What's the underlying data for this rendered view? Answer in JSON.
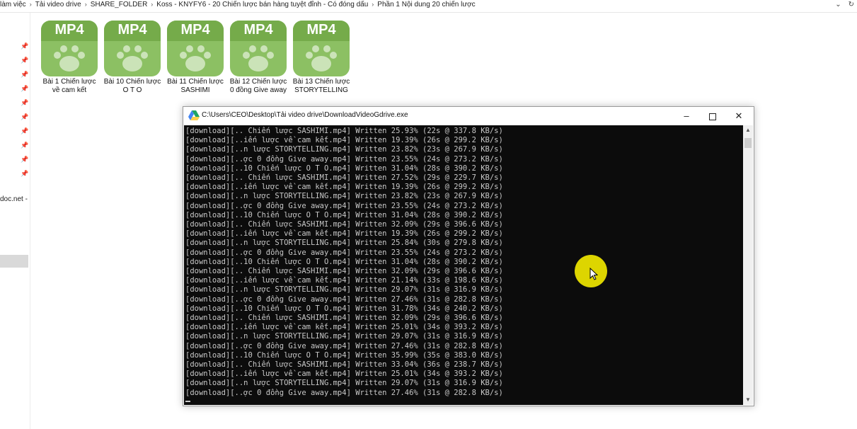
{
  "explorer": {
    "breadcrumb": [
      "làm việc",
      "Tải video drive",
      "SHARE_FOLDER",
      "Koss - KNYFY6 - 20 Chiến lược bán hàng tuyệt đỉnh - Có đóng dấu",
      "Phần 1 Nội dung 20 chiến lược"
    ],
    "sidebar_text": "doc.net -",
    "files": [
      {
        "badge": "MP4",
        "name": "Bài 1 Chiến lược về cam kết"
      },
      {
        "badge": "MP4",
        "name": "Bài 10 Chiến lược O T O"
      },
      {
        "badge": "MP4",
        "name": "Bài 11 Chiến lược SASHIMI"
      },
      {
        "badge": "MP4",
        "name": "Bài 12 Chiến lược 0 đồng Give away"
      },
      {
        "badge": "MP4",
        "name": "Bài 13 Chiến lược STORYTELLING"
      }
    ],
    "icons": {
      "chevron": "chevron-right-icon",
      "pin": "pin-icon",
      "file": "mp4-file-icon",
      "refresh": "refresh-icon"
    }
  },
  "console": {
    "title": "C:\\Users\\CEO\\Desktop\\Tải video drive\\DownloadVideoGdrive.exe",
    "buttons": {
      "minimize": "–",
      "close": "✕"
    },
    "lines": [
      "[download][.. Chiến lược SASHIMI.mp4] Written 25.93% (22s @ 337.8 KB/s)",
      "[download][..iến lược về cam kết.mp4] Written 19.39% (26s @ 299.2 KB/s)",
      "[download][..n lược STORYTELLING.mp4] Written 23.82% (23s @ 267.9 KB/s)",
      "[download][..ợc 0 đồng Give away.mp4] Written 23.55% (24s @ 273.2 KB/s)",
      "[download][..10 Chiến lược O T O.mp4] Written 31.04% (28s @ 390.2 KB/s)",
      "[download][.. Chiến lược SASHIMI.mp4] Written 27.52% (29s @ 229.7 KB/s)",
      "[download][..iến lược về cam kết.mp4] Written 19.39% (26s @ 299.2 KB/s)",
      "[download][..n lược STORYTELLING.mp4] Written 23.82% (23s @ 267.9 KB/s)",
      "[download][..ợc 0 đồng Give away.mp4] Written 23.55% (24s @ 273.2 KB/s)",
      "[download][..10 Chiến lược O T O.mp4] Written 31.04% (28s @ 390.2 KB/s)",
      "[download][.. Chiến lược SASHIMI.mp4] Written 32.09% (29s @ 396.6 KB/s)",
      "[download][..iến lược về cam kết.mp4] Written 19.39% (26s @ 299.2 KB/s)",
      "[download][..n lược STORYTELLING.mp4] Written 25.84% (30s @ 279.8 KB/s)",
      "[download][..ợc 0 đồng Give away.mp4] Written 23.55% (24s @ 273.2 KB/s)",
      "[download][..10 Chiến lược O T O.mp4] Written 31.04% (28s @ 390.2 KB/s)",
      "[download][.. Chiến lược SASHIMI.mp4] Written 32.09% (29s @ 396.6 KB/s)",
      "[download][..iến lược về cam kết.mp4] Written 21.14% (33s @ 198.6 KB/s)",
      "[download][..n lược STORYTELLING.mp4] Written 29.07% (31s @ 316.9 KB/s)",
      "[download][..ợc 0 đồng Give away.mp4] Written 27.46% (31s @ 282.8 KB/s)",
      "[download][..10 Chiến lược O T O.mp4] Written 31.78% (34s @ 240.2 KB/s)",
      "[download][.. Chiến lược SASHIMI.mp4] Written 32.09% (29s @ 396.6 KB/s)",
      "[download][..iến lược về cam kết.mp4] Written 25.01% (34s @ 393.2 KB/s)",
      "[download][..n lược STORYTELLING.mp4] Written 29.07% (31s @ 316.9 KB/s)",
      "[download][..ợc 0 đồng Give away.mp4] Written 27.46% (31s @ 282.8 KB/s)",
      "[download][..10 Chiến lược O T O.mp4] Written 35.99% (35s @ 383.0 KB/s)",
      "[download][.. Chiến lược SASHIMI.mp4] Written 33.04% (36s @ 238.7 KB/s)",
      "[download][..iến lược về cam kết.mp4] Written 25.01% (34s @ 393.2 KB/s)",
      "[download][..n lược STORYTELLING.mp4] Written 29.07% (31s @ 316.9 KB/s)",
      "[download][..ợc 0 đồng Give away.mp4] Written 27.46% (31s @ 282.8 KB/s)"
    ],
    "icons": {
      "app": "google-drive-icon",
      "minimize": "minimize-icon",
      "maximize": "maximize-icon",
      "close": "close-icon"
    }
  },
  "colors": {
    "mp4_green": "#8cc063",
    "terminal_bg": "#0c0c0c",
    "terminal_text": "#c8c8c8",
    "cursor_highlight": "#e9e000"
  }
}
